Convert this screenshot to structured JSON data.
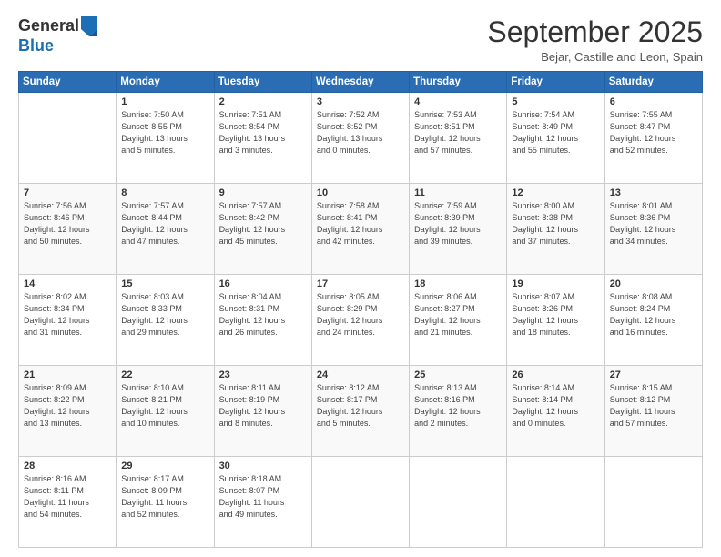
{
  "header": {
    "logo_general": "General",
    "logo_blue": "Blue",
    "month_title": "September 2025",
    "location": "Bejar, Castille and Leon, Spain"
  },
  "days_of_week": [
    "Sunday",
    "Monday",
    "Tuesday",
    "Wednesday",
    "Thursday",
    "Friday",
    "Saturday"
  ],
  "weeks": [
    [
      {
        "num": "",
        "info": ""
      },
      {
        "num": "1",
        "info": "Sunrise: 7:50 AM\nSunset: 8:55 PM\nDaylight: 13 hours\nand 5 minutes."
      },
      {
        "num": "2",
        "info": "Sunrise: 7:51 AM\nSunset: 8:54 PM\nDaylight: 13 hours\nand 3 minutes."
      },
      {
        "num": "3",
        "info": "Sunrise: 7:52 AM\nSunset: 8:52 PM\nDaylight: 13 hours\nand 0 minutes."
      },
      {
        "num": "4",
        "info": "Sunrise: 7:53 AM\nSunset: 8:51 PM\nDaylight: 12 hours\nand 57 minutes."
      },
      {
        "num": "5",
        "info": "Sunrise: 7:54 AM\nSunset: 8:49 PM\nDaylight: 12 hours\nand 55 minutes."
      },
      {
        "num": "6",
        "info": "Sunrise: 7:55 AM\nSunset: 8:47 PM\nDaylight: 12 hours\nand 52 minutes."
      }
    ],
    [
      {
        "num": "7",
        "info": "Sunrise: 7:56 AM\nSunset: 8:46 PM\nDaylight: 12 hours\nand 50 minutes."
      },
      {
        "num": "8",
        "info": "Sunrise: 7:57 AM\nSunset: 8:44 PM\nDaylight: 12 hours\nand 47 minutes."
      },
      {
        "num": "9",
        "info": "Sunrise: 7:57 AM\nSunset: 8:42 PM\nDaylight: 12 hours\nand 45 minutes."
      },
      {
        "num": "10",
        "info": "Sunrise: 7:58 AM\nSunset: 8:41 PM\nDaylight: 12 hours\nand 42 minutes."
      },
      {
        "num": "11",
        "info": "Sunrise: 7:59 AM\nSunset: 8:39 PM\nDaylight: 12 hours\nand 39 minutes."
      },
      {
        "num": "12",
        "info": "Sunrise: 8:00 AM\nSunset: 8:38 PM\nDaylight: 12 hours\nand 37 minutes."
      },
      {
        "num": "13",
        "info": "Sunrise: 8:01 AM\nSunset: 8:36 PM\nDaylight: 12 hours\nand 34 minutes."
      }
    ],
    [
      {
        "num": "14",
        "info": "Sunrise: 8:02 AM\nSunset: 8:34 PM\nDaylight: 12 hours\nand 31 minutes."
      },
      {
        "num": "15",
        "info": "Sunrise: 8:03 AM\nSunset: 8:33 PM\nDaylight: 12 hours\nand 29 minutes."
      },
      {
        "num": "16",
        "info": "Sunrise: 8:04 AM\nSunset: 8:31 PM\nDaylight: 12 hours\nand 26 minutes."
      },
      {
        "num": "17",
        "info": "Sunrise: 8:05 AM\nSunset: 8:29 PM\nDaylight: 12 hours\nand 24 minutes."
      },
      {
        "num": "18",
        "info": "Sunrise: 8:06 AM\nSunset: 8:27 PM\nDaylight: 12 hours\nand 21 minutes."
      },
      {
        "num": "19",
        "info": "Sunrise: 8:07 AM\nSunset: 8:26 PM\nDaylight: 12 hours\nand 18 minutes."
      },
      {
        "num": "20",
        "info": "Sunrise: 8:08 AM\nSunset: 8:24 PM\nDaylight: 12 hours\nand 16 minutes."
      }
    ],
    [
      {
        "num": "21",
        "info": "Sunrise: 8:09 AM\nSunset: 8:22 PM\nDaylight: 12 hours\nand 13 minutes."
      },
      {
        "num": "22",
        "info": "Sunrise: 8:10 AM\nSunset: 8:21 PM\nDaylight: 12 hours\nand 10 minutes."
      },
      {
        "num": "23",
        "info": "Sunrise: 8:11 AM\nSunset: 8:19 PM\nDaylight: 12 hours\nand 8 minutes."
      },
      {
        "num": "24",
        "info": "Sunrise: 8:12 AM\nSunset: 8:17 PM\nDaylight: 12 hours\nand 5 minutes."
      },
      {
        "num": "25",
        "info": "Sunrise: 8:13 AM\nSunset: 8:16 PM\nDaylight: 12 hours\nand 2 minutes."
      },
      {
        "num": "26",
        "info": "Sunrise: 8:14 AM\nSunset: 8:14 PM\nDaylight: 12 hours\nand 0 minutes."
      },
      {
        "num": "27",
        "info": "Sunrise: 8:15 AM\nSunset: 8:12 PM\nDaylight: 11 hours\nand 57 minutes."
      }
    ],
    [
      {
        "num": "28",
        "info": "Sunrise: 8:16 AM\nSunset: 8:11 PM\nDaylight: 11 hours\nand 54 minutes."
      },
      {
        "num": "29",
        "info": "Sunrise: 8:17 AM\nSunset: 8:09 PM\nDaylight: 11 hours\nand 52 minutes."
      },
      {
        "num": "30",
        "info": "Sunrise: 8:18 AM\nSunset: 8:07 PM\nDaylight: 11 hours\nand 49 minutes."
      },
      {
        "num": "",
        "info": ""
      },
      {
        "num": "",
        "info": ""
      },
      {
        "num": "",
        "info": ""
      },
      {
        "num": "",
        "info": ""
      }
    ]
  ]
}
